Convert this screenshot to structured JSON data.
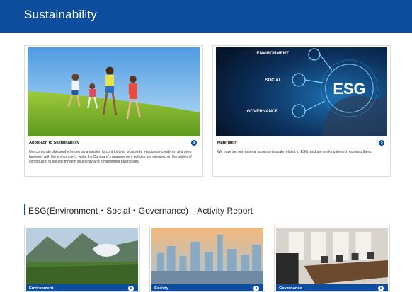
{
  "header": {
    "title": "Sustainability"
  },
  "cards": [
    {
      "title": "Approach to Sustainability",
      "description": "Our corporate philosophy hinges on a mission to contribute to prosperity, encourage creativity, and seek harmony with the environment, while the Company's management policies are centered on the notion of contributing to society through its energy and environment businesses.",
      "image": "children-running-on-grass-photo"
    },
    {
      "title": "Materiality",
      "description": "We have set out material issues and goals related to ESG, and are working toward resolving them.",
      "image": "esg-digital-graphic",
      "graphic_labels": {
        "environment": "ENVIRONMENT",
        "social": "SOCIAL",
        "governance": "GOVERNANCE",
        "center": "ESG"
      }
    }
  ],
  "section": {
    "title": "ESG(Environment・Social・Governance)　Activity Report"
  },
  "reports": [
    {
      "label": "Environment",
      "image": "mountain-landscape-photo"
    },
    {
      "label": "Society",
      "image": "city-skyline-photo"
    },
    {
      "label": "Governance",
      "image": "boardroom-photo"
    }
  ],
  "colors": {
    "brand_blue": "#0c4d9e",
    "background": "#ffffff"
  }
}
